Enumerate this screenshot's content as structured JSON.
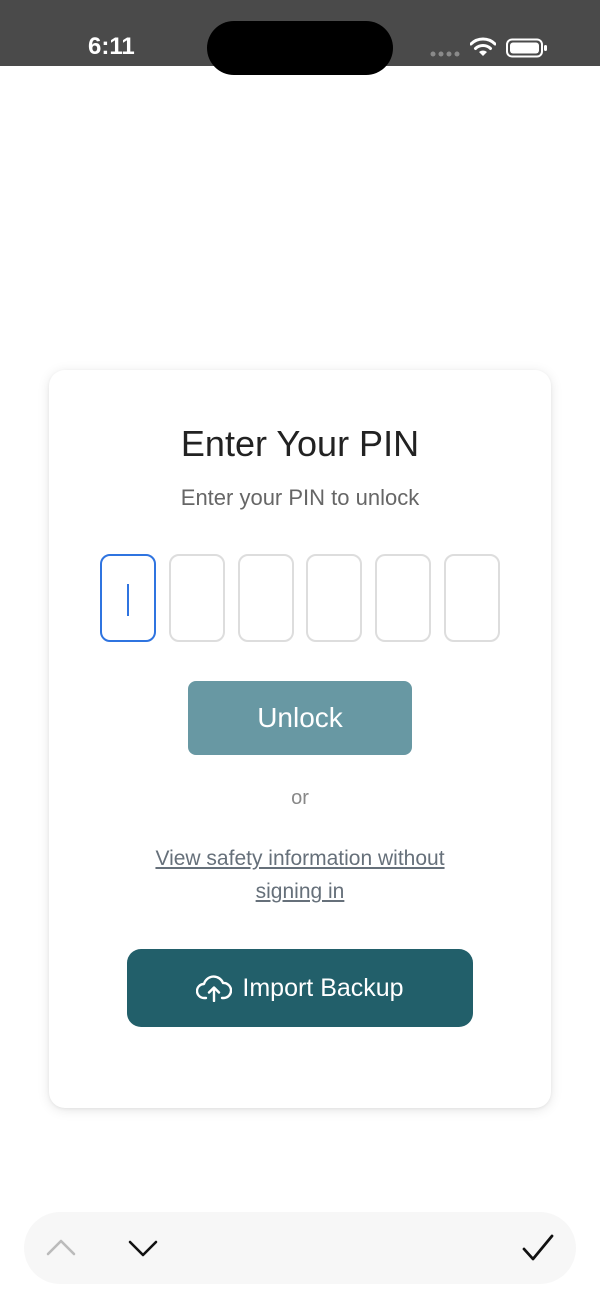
{
  "status_bar": {
    "time": "6:11"
  },
  "card": {
    "title": "Enter Your PIN",
    "subtitle": "Enter your PIN to unlock",
    "pin_length": 6,
    "unlock_label": "Unlock",
    "or_label": "or",
    "safety_link": "View safety information without signing in",
    "import_label": "Import Backup"
  },
  "icons": {
    "import": "cloud-upload-icon",
    "toolbar_up": "chevron-up-icon",
    "toolbar_down": "chevron-down-icon",
    "toolbar_done": "checkmark-icon"
  },
  "colors": {
    "unlock_button": "#6898a3",
    "import_button": "#225f6a",
    "active_pin_border": "#2f74e0"
  }
}
